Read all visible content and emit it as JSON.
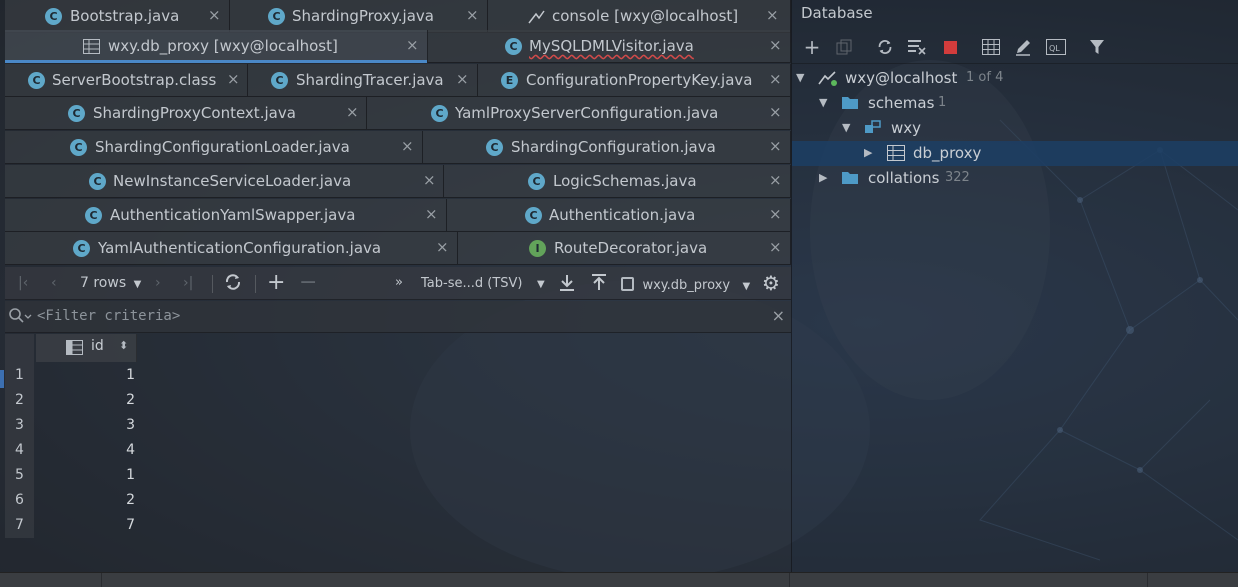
{
  "editor_tabs": {
    "row1": [
      {
        "label": "Bootstrap.java",
        "icon": "class-icon"
      },
      {
        "label": "ShardingProxy.java",
        "icon": "class-icon"
      },
      {
        "label": "console [wxy@localhost]",
        "icon": "console-icon"
      }
    ],
    "row2": [
      {
        "label": "wxy.db_proxy [wxy@localhost]",
        "icon": "table-icon"
      },
      {
        "label": "MySQLDMLVisitor.java",
        "icon": "class-icon"
      }
    ],
    "row3": [
      {
        "label": "ServerBootstrap.class",
        "icon": "class-icon"
      },
      {
        "label": "ShardingTracer.java",
        "icon": "class-icon"
      },
      {
        "label": "ConfigurationPropertyKey.java",
        "icon": "enum-icon"
      }
    ],
    "row4": [
      {
        "label": "ShardingProxyContext.java",
        "icon": "class-icon"
      },
      {
        "label": "YamlProxyServerConfiguration.java",
        "icon": "class-icon"
      }
    ],
    "row5": [
      {
        "label": "ShardingConfigurationLoader.java",
        "icon": "class-icon"
      },
      {
        "label": "ShardingConfiguration.java",
        "icon": "class-icon"
      }
    ],
    "row6": [
      {
        "label": "NewInstanceServiceLoader.java",
        "icon": "class-icon"
      },
      {
        "label": "LogicSchemas.java",
        "icon": "class-icon"
      }
    ],
    "row7": [
      {
        "label": "AuthenticationYamlSwapper.java",
        "icon": "class-icon"
      },
      {
        "label": "Authentication.java",
        "icon": "class-icon"
      }
    ],
    "row8": [
      {
        "label": "YamlAuthenticationConfiguration.java",
        "icon": "class-icon"
      },
      {
        "label": "RouteDecorator.java",
        "icon": "interface-icon"
      }
    ],
    "close_glyph": "×"
  },
  "grid_toolbar": {
    "rows_label": "7 rows",
    "export_format": "Tab-se...d (TSV)",
    "datasource": "wxy.db_proxy",
    "more_glyph": "»"
  },
  "filter": {
    "placeholder": "<Filter criteria>"
  },
  "result_grid": {
    "column_header": "id",
    "rows": [
      {
        "num": "1",
        "id": "1"
      },
      {
        "num": "2",
        "id": "2"
      },
      {
        "num": "3",
        "id": "3"
      },
      {
        "num": "4",
        "id": "4"
      },
      {
        "num": "5",
        "id": "1"
      },
      {
        "num": "6",
        "id": "2"
      },
      {
        "num": "7",
        "id": "7"
      }
    ]
  },
  "database_panel": {
    "title": "Database",
    "tree": {
      "connection": {
        "label": "wxy@localhost",
        "count": "1 of 4"
      },
      "schemas": {
        "label": "schemas",
        "count": "1"
      },
      "schema": {
        "label": "wxy"
      },
      "table": {
        "label": "db_proxy"
      },
      "collations": {
        "label": "collations",
        "count": "322"
      }
    }
  },
  "colors": {
    "accent_blue": "#4a88c7",
    "selection": "#1c3e64",
    "stop_red": "#d23c3c",
    "class_icon": "#5fa8c9",
    "interface_icon": "#62a35a"
  }
}
